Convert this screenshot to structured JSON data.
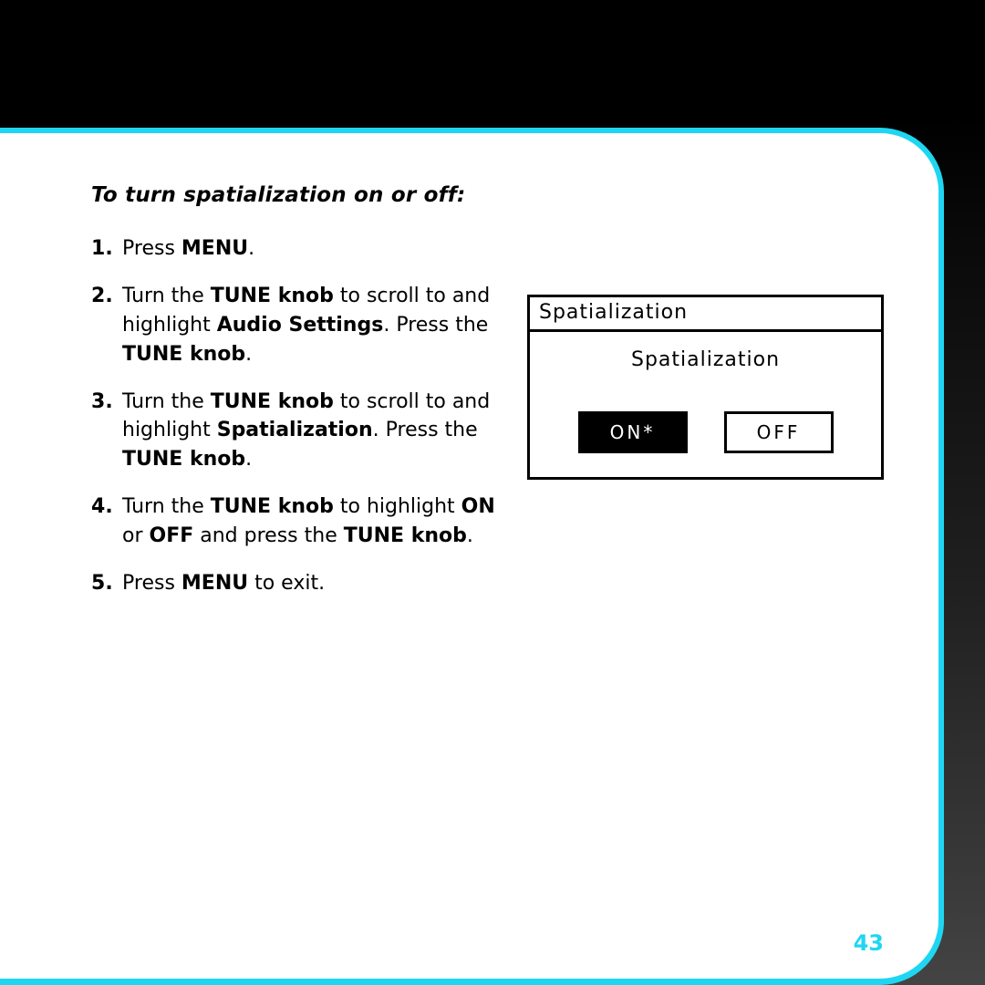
{
  "heading": "To turn spatialization on or off:",
  "steps": {
    "s1": {
      "a": "Press ",
      "b": "MENU",
      "c": "."
    },
    "s2": {
      "a": "Turn the ",
      "b": "TUNE knob",
      "c": " to scroll to and highlight ",
      "d": "Audio Settings",
      "e": ". Press the ",
      "f": "TUNE knob",
      "g": "."
    },
    "s3": {
      "a": "Turn the ",
      "b": "TUNE knob",
      "c": " to scroll to and highlight ",
      "d": "Spatialization",
      "e": ". Press the ",
      "f": "TUNE knob",
      "g": "."
    },
    "s4": {
      "a": "Turn the ",
      "b": "TUNE knob",
      "c": " to highlight ",
      "d": "ON",
      "e": " or ",
      "f": "OFF",
      "g": " and press the ",
      "h": "TUNE knob",
      "i": "."
    },
    "s5": {
      "a": "Press ",
      "b": "MENU",
      "c": " to exit."
    }
  },
  "device": {
    "title": "Spatialization",
    "label": "Spatialization",
    "on": "ON*",
    "off": "OFF"
  },
  "page_number": "43"
}
